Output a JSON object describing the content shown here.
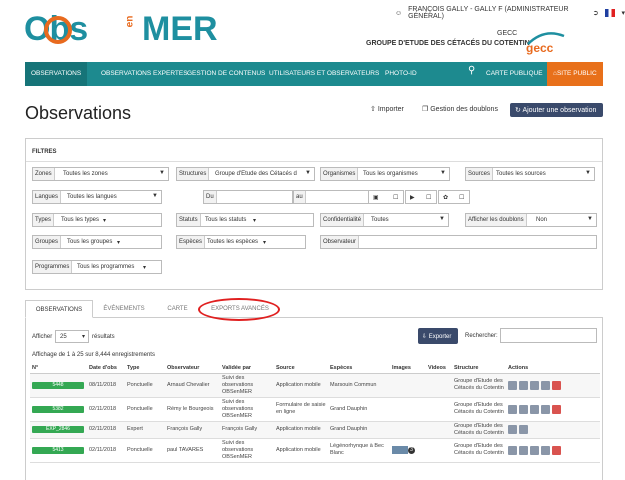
{
  "logo": {
    "part1": "Obs",
    "part2": "MER",
    "vertical": "en"
  },
  "user": {
    "name": "FRANÇOIS GALLY - GALLY F (ADMINISTRATEUR GÉNÉRAL)"
  },
  "org": {
    "short": "GECC",
    "full": "GROUPE D'ETUDE DES CÉTACÉS DU COTENTIN"
  },
  "nav": {
    "items": [
      "OBSERVATIONS",
      "OBSERVATIONS EXPERTES",
      "GESTION DE CONTENUS",
      "UTILISATEURS ET OBSERVATEURS",
      "PHOTO-ID"
    ],
    "carte": "CARTE PUBLIQUE",
    "site": "SITE PUBLIC"
  },
  "page": {
    "title": "Observations",
    "importer": "Importer",
    "doublons": "Gestion des doublons",
    "add": "Ajouter une observation"
  },
  "filters": {
    "header": "FILTRES",
    "zones": {
      "label": "Zones",
      "value": "Toutes les zones"
    },
    "structures": {
      "label": "Structures",
      "value": "Groupe d'Etude des Cétacés d"
    },
    "organismes": {
      "label": "Organismes",
      "value": "Tous les organismes"
    },
    "sources": {
      "label": "Sources",
      "value": "Toutes les sources"
    },
    "langues": {
      "label": "Langues",
      "value": "Toutes les langues"
    },
    "du": "Du",
    "au": "au",
    "types": {
      "label": "Types",
      "value": "Tous les types"
    },
    "statuts": {
      "label": "Statuts",
      "value": "Tous les statuts"
    },
    "confidentialite": {
      "label": "Confidentialité",
      "value": "Toutes"
    },
    "doublons": {
      "label": "Afficher les doublons",
      "value": "Non"
    },
    "groupes": {
      "label": "Groupes",
      "value": "Tous les groupes"
    },
    "especes": {
      "label": "Espèces",
      "value": "Toutes les espèces"
    },
    "observateur": {
      "label": "Observateur"
    },
    "programmes": {
      "label": "Programmes",
      "value": "Tous les programmes"
    }
  },
  "tabs": [
    "OBSERVATIONS",
    "ÉVÉNEMENTS",
    "CARTE",
    "EXPORTS AVANCÉS"
  ],
  "list": {
    "afficher": "Afficher",
    "per_page": "25",
    "resultats": "résultats",
    "exporter": "Exporter",
    "rechercher": "Rechercher:",
    "info": "Affichage de 1 à 25 sur 8,444 enregistrements"
  },
  "columns": [
    "N°",
    "Date d'obs",
    "Type",
    "Observateur",
    "Validée par",
    "Source",
    "Espèces",
    "Images",
    "Videos",
    "Structure",
    "Actions"
  ],
  "rows": [
    {
      "id": "5448",
      "date": "08/11/2018",
      "type": "Ponctuelle",
      "obs": "Arnaud Chevalier",
      "valid": "Suivi des observations OBSenMER",
      "source": "Application mobile",
      "esp": "Marsouin Commun",
      "img": "",
      "struct": "Groupe d'Etude des Cétacés du Cotentin"
    },
    {
      "id": "5382",
      "date": "02/11/2018",
      "type": "Ponctuelle",
      "obs": "Rémy le Bourgeois",
      "valid": "Suivi des observations OBSenMER",
      "source": "Formulaire de saisie en ligne",
      "esp": "Grand Dauphin",
      "img": "",
      "struct": "Groupe d'Etude des Cétacés du Cotentin"
    },
    {
      "id": "EXP_2846",
      "date": "02/11/2018",
      "type": "Expert",
      "obs": "François Gally",
      "valid": "François Gally",
      "source": "Application mobile",
      "esp": "Grand Dauphin",
      "img": "",
      "struct": "Groupe d'Etude des Cétacés du Cotentin"
    },
    {
      "id": "5413",
      "date": "02/11/2018",
      "type": "Ponctuelle",
      "obs": "paul TAVARES",
      "valid": "Suivi des observations OBSenMER",
      "source": "Application mobile",
      "esp": "Légénorhynque à Bec Blanc",
      "img": "3",
      "struct": "Groupe d'Etude des Cétacés du Cotentin"
    }
  ]
}
